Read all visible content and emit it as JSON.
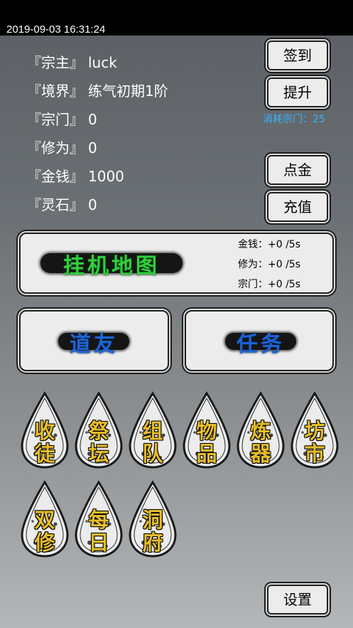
{
  "status_bar": {
    "datetime": "2019-09-03 16:31:24"
  },
  "stats": [
    {
      "label": "『宗主』",
      "value": "luck"
    },
    {
      "label": "『境界』",
      "value": "练气初期1阶"
    },
    {
      "label": "『宗门』",
      "value": "0"
    },
    {
      "label": "『修为』",
      "value": "0"
    },
    {
      "label": "『金钱』",
      "value": "1000"
    },
    {
      "label": "『灵石』",
      "value": "0"
    }
  ],
  "buttons": {
    "checkin": "签到",
    "upgrade": "提升",
    "upgrade_cost": "消耗宗门：25",
    "gold_tap": "点金",
    "recharge": "充值",
    "settings": "设置"
  },
  "idle_map": {
    "title": "挂机地图",
    "rates": [
      {
        "label": "金钱：",
        "value": "+0 /5s"
      },
      {
        "label": "修为：",
        "value": "+0 /5s"
      },
      {
        "label": "宗门：",
        "value": "+0 /5s"
      }
    ]
  },
  "panels": {
    "friends": "道友",
    "tasks": "任务"
  },
  "menu": [
    {
      "top": "收",
      "bottom": "徒"
    },
    {
      "top": "祭",
      "bottom": "坛"
    },
    {
      "top": "组",
      "bottom": "队"
    },
    {
      "top": "物",
      "bottom": "品"
    },
    {
      "top": "炼",
      "bottom": "器"
    },
    {
      "top": "坊",
      "bottom": "市"
    },
    {
      "top": "双",
      "bottom": "修"
    },
    {
      "top": "每",
      "bottom": "日"
    },
    {
      "top": "洞",
      "bottom": "府"
    }
  ],
  "colors": {
    "accent_blue": "#3ab2ff",
    "map_title_green": "#2fcf3c",
    "panel_title_blue": "#1c64d6",
    "menu_gold": "#e6bd2a"
  }
}
